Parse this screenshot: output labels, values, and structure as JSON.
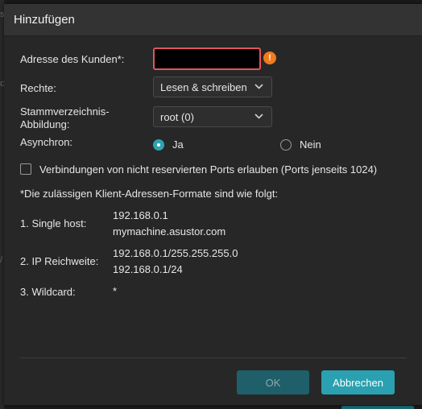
{
  "background": {
    "frag1": "s",
    "frag2": "c",
    "frag3": "/"
  },
  "dialog": {
    "title": "Hinzufügen",
    "fields": {
      "customer_address_label": "Adresse des Kunden*:",
      "customer_address_value": "",
      "warning_glyph": "!",
      "rights_label": "Rechte:",
      "rights_value": "Lesen & schreiben",
      "root_mapping_label_line1": "Stammverzeichnis-",
      "root_mapping_label_line2": "Abbildung:",
      "root_mapping_value": "root (0)",
      "async_label": "Asynchron:",
      "async_yes": "Ja",
      "async_no": "Nein",
      "async_selected": "Ja",
      "allow_ports_label": "Verbindungen von nicht reservierten Ports erlauben (Ports jenseits 1024)",
      "allow_ports_checked": false
    },
    "formats": {
      "heading": "*Die zulässigen Klient-Adressen-Formate sind wie folgt:",
      "items": [
        {
          "label": "1. Single host:",
          "values": [
            "192.168.0.1",
            "mymachine.asustor.com"
          ]
        },
        {
          "label": "2. IP Reichweite:",
          "values": [
            "192.168.0.1/255.255.255.0",
            "192.168.0.1/24"
          ]
        },
        {
          "label": "3. Wildcard:",
          "values": [
            "*"
          ]
        }
      ]
    },
    "buttons": {
      "ok": "OK",
      "cancel": "Abbrechen"
    }
  },
  "colors": {
    "accent": "#2aa0b0",
    "error_border": "#e0565b",
    "warning": "#f07a1e"
  }
}
